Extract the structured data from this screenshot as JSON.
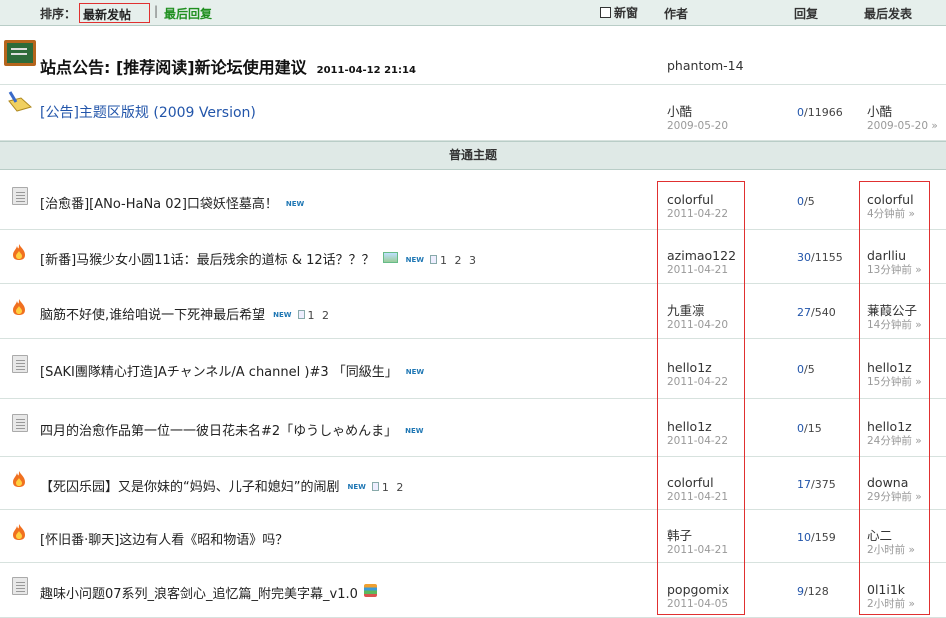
{
  "header": {
    "sort_label": "排序：",
    "sort_latest": "最新发帖",
    "sort_sep": "|",
    "sort_lastreply": "最后回复",
    "new_window": "新窗",
    "col_author": "作者",
    "col_replies": "回复",
    "col_last": "最后发表"
  },
  "pinned": [
    {
      "title_prefix": "站点公告: ",
      "title": "[推荐阅读]新论坛使用建议",
      "date": "2011-04-12 21:14",
      "author": "phantom-14"
    },
    {
      "title": "[公告]主题区版规 (2009 Version)",
      "author": "小酷",
      "author_date": "2009-05-20",
      "replies": "0",
      "views": "/11966",
      "last_user": "小酷",
      "last_time": "2009-05-20 »"
    }
  ],
  "section_label": "普通主题",
  "threads": [
    {
      "icon": "document-icon",
      "title": "[治愈番][ANo-HaNa 02]口袋妖怪墓高！",
      "new": "NEW",
      "pages": "",
      "author": "colorful",
      "author_date": "2011-04-22",
      "replies": "0",
      "views": "/5",
      "last_user": "colorful",
      "last_time": "4分钟前 »"
    },
    {
      "icon": "fire-icon",
      "title": "[新番]马猴少女小圆11话：最后残余的道标 & 12话？？？",
      "image": true,
      "new": "NEW",
      "pages": "1 2 3",
      "author": "azimao122",
      "author_date": "2011-04-21",
      "replies": "30",
      "views": "/1155",
      "last_user": "darlliu",
      "last_time": "13分钟前 »"
    },
    {
      "icon": "fire-icon",
      "title": "脑筋不好使,谁给咱说一下死神最后希望",
      "new": "NEW",
      "pages": "1 2",
      "author": "九重凛",
      "author_date": "2011-04-20",
      "replies": "27",
      "views": "/540",
      "last_user": "蒹葭公子",
      "last_time": "14分钟前 »"
    },
    {
      "icon": "document-icon",
      "title": "[SAKI團隊精心打造]Aチャンネル/A channel )#3 「同級生」",
      "new": "NEW",
      "pages": "",
      "author": "hello1z",
      "author_date": "2011-04-22",
      "replies": "0",
      "views": "/5",
      "last_user": "hello1z",
      "last_time": "15分钟前 »"
    },
    {
      "icon": "document-icon",
      "title": "四月的治愈作品第一位一一彼日花未名#2「ゆうしゃめんま」",
      "new": "NEW",
      "pages": "",
      "author": "hello1z",
      "author_date": "2011-04-22",
      "replies": "0",
      "views": "/15",
      "last_user": "hello1z",
      "last_time": "24分钟前 »"
    },
    {
      "icon": "fire-icon",
      "title": "【死囚乐园】又是你妹的“妈妈、儿子和媳妇”的闹剧",
      "new": "NEW",
      "pages": "1 2",
      "author": "colorful",
      "author_date": "2011-04-21",
      "replies": "17",
      "views": "/375",
      "last_user": "downa",
      "last_time": "29分钟前 »"
    },
    {
      "icon": "fire-icon",
      "title": "[怀旧番·聊天]这边有人看《昭和物语》吗？",
      "new": "",
      "pages": "",
      "author": "韩子",
      "author_date": "2011-04-21",
      "replies": "10",
      "views": "/159",
      "last_user": "心二",
      "last_time": "2小时前 »"
    },
    {
      "icon": "document-icon",
      "title": "趣味小问题07系列_浪客剑心_追忆篇_附完美字幕_v1.0",
      "stack": true,
      "new": "",
      "pages": "",
      "author": "popgomix",
      "author_date": "2011-04-05",
      "replies": "9",
      "views": "/128",
      "last_user": "0l1i1k",
      "last_time": "2小时前 »"
    }
  ]
}
